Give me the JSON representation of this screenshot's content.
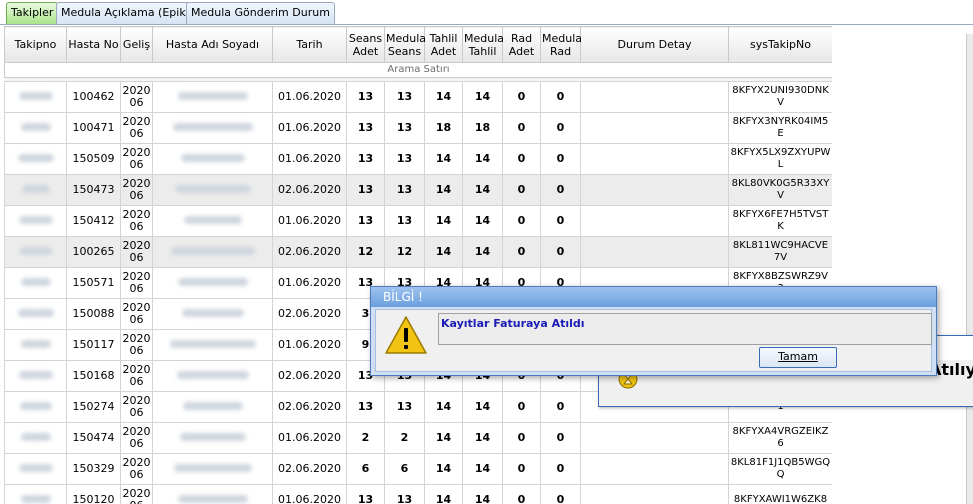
{
  "tabs": [
    {
      "label": "Takipler",
      "active": true
    },
    {
      "label": "Medula Açıklama (Epikriz)",
      "active": false
    },
    {
      "label": "Medula Gönderim Durum",
      "active": false
    }
  ],
  "grid": {
    "columns": [
      {
        "label": "Takipno"
      },
      {
        "label": "Hasta No"
      },
      {
        "label": "Geliş"
      },
      {
        "label": "Hasta Adı Soyadı"
      },
      {
        "label": "Tarih"
      },
      {
        "label": "Seans\nAdet"
      },
      {
        "label": "Medula\nSeans"
      },
      {
        "label": "Tahlil\nAdet"
      },
      {
        "label": "Medula\nTahlil"
      },
      {
        "label": "Rad\nAdet"
      },
      {
        "label": "Medula\nRad"
      },
      {
        "label": "Durum Detay"
      },
      {
        "label": "sysTakipNo"
      }
    ],
    "search_row_label": "Arama Satırı",
    "rows": [
      {
        "hasta_no": "100462",
        "gelis": "2020\n06",
        "tarih": "01.06.2020",
        "seans": "13",
        "medula_seans": "13",
        "tahlil": "14",
        "medula_tahlil": "14",
        "rad": "0",
        "medula_rad": "0",
        "durum": "",
        "sys": "8KFYX2UNI930DNKV",
        "shaded": false
      },
      {
        "hasta_no": "100471",
        "gelis": "2020\n06",
        "tarih": "01.06.2020",
        "seans": "13",
        "medula_seans": "13",
        "tahlil": "18",
        "medula_tahlil": "18",
        "rad": "0",
        "medula_rad": "0",
        "durum": "",
        "sys": "8KFYX3NYRK04IM5E",
        "shaded": false
      },
      {
        "hasta_no": "150509",
        "gelis": "2020\n06",
        "tarih": "01.06.2020",
        "seans": "13",
        "medula_seans": "13",
        "tahlil": "14",
        "medula_tahlil": "14",
        "rad": "0",
        "medula_rad": "0",
        "durum": "",
        "sys": "8KFYX5LX9ZXYUPWL",
        "shaded": false
      },
      {
        "hasta_no": "150473",
        "gelis": "2020\n06",
        "tarih": "02.06.2020",
        "seans": "13",
        "medula_seans": "13",
        "tahlil": "14",
        "medula_tahlil": "14",
        "rad": "0",
        "medula_rad": "0",
        "durum": "",
        "sys": "8KL80VK0G5R33XYV",
        "shaded": true
      },
      {
        "hasta_no": "150412",
        "gelis": "2020\n06",
        "tarih": "01.06.2020",
        "seans": "13",
        "medula_seans": "13",
        "tahlil": "14",
        "medula_tahlil": "14",
        "rad": "0",
        "medula_rad": "0",
        "durum": "",
        "sys": "8KFYX6FE7H5TVSTK",
        "shaded": false
      },
      {
        "hasta_no": "100265",
        "gelis": "2020\n06",
        "tarih": "02.06.2020",
        "seans": "12",
        "medula_seans": "12",
        "tahlil": "14",
        "medula_tahlil": "14",
        "rad": "0",
        "medula_rad": "0",
        "durum": "",
        "sys": "8KL811WC9HACVE7V",
        "shaded": true
      },
      {
        "hasta_no": "150571",
        "gelis": "2020\n06",
        "tarih": "01.06.2020",
        "seans": "13",
        "medula_seans": "13",
        "tahlil": "14",
        "medula_tahlil": "14",
        "rad": "0",
        "medula_rad": "0",
        "durum": "",
        "sys": "8KFYX8BZSWRZ9V3",
        "shaded": false
      },
      {
        "hasta_no": "150088",
        "gelis": "2020\n06",
        "tarih": "02.06.2020",
        "seans": "3",
        "medula_seans": "3",
        "tahlil": "14",
        "medula_tahlil": "14",
        "rad": "0",
        "medula_rad": "0",
        "durum": "",
        "sys": "",
        "shaded": false
      },
      {
        "hasta_no": "150117",
        "gelis": "2020\n06",
        "tarih": "01.06.2020",
        "seans": "9",
        "medula_seans": "9",
        "tahlil": "14",
        "medula_tahlil": "14",
        "rad": "0",
        "medula_rad": "0",
        "durum": "",
        "sys": "",
        "shaded": false
      },
      {
        "hasta_no": "150168",
        "gelis": "2020\n06",
        "tarih": "02.06.2020",
        "seans": "13",
        "medula_seans": "13",
        "tahlil": "14",
        "medula_tahlil": "14",
        "rad": "0",
        "medula_rad": "0",
        "durum": "",
        "sys": "",
        "shaded": false
      },
      {
        "hasta_no": "150274",
        "gelis": "2020\n06",
        "tarih": "02.06.2020",
        "seans": "13",
        "medula_seans": "13",
        "tahlil": "14",
        "medula_tahlil": "14",
        "rad": "0",
        "medula_rad": "0",
        "durum": "",
        "sys": "1",
        "shaded": false
      },
      {
        "hasta_no": "150474",
        "gelis": "2020\n06",
        "tarih": "01.06.2020",
        "seans": "2",
        "medula_seans": "2",
        "tahlil": "14",
        "medula_tahlil": "14",
        "rad": "0",
        "medula_rad": "0",
        "durum": "",
        "sys": "8KFYXA4VRGZEIKZ6",
        "shaded": false
      },
      {
        "hasta_no": "150329",
        "gelis": "2020\n06",
        "tarih": "02.06.2020",
        "seans": "6",
        "medula_seans": "6",
        "tahlil": "14",
        "medula_tahlil": "14",
        "rad": "0",
        "medula_rad": "0",
        "durum": "",
        "sys": "8KL81F1J1QB5WGQQ",
        "shaded": false
      },
      {
        "hasta_no": "150120",
        "gelis": "2020\n06",
        "tarih": "01.06.2020",
        "seans": "13",
        "medula_seans": "13",
        "tahlil": "14",
        "medula_tahlil": "14",
        "rad": "0",
        "medula_rad": "0",
        "durum": "",
        "sys": "8KFYXAWI1W6ZK8",
        "shaded": false
      }
    ]
  },
  "background_dialog": {
    "text": "Atılıyo"
  },
  "dialog": {
    "title": "BİLGİ !",
    "message": "Kayıtlar Faturaya Atıldı",
    "ok_label": "Tamam"
  },
  "colors": {
    "active_tab": "#a8e58a",
    "dialog_title": "#6a9fde",
    "message_text": "#1c1cb8",
    "warning_icon": "#f2c416"
  }
}
